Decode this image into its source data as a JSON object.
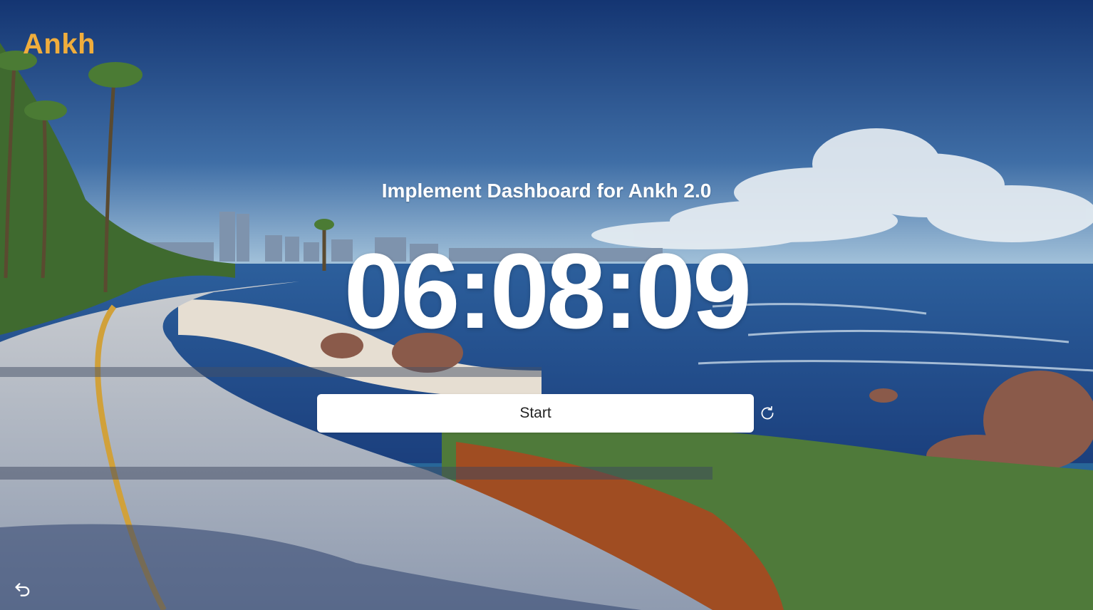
{
  "brand": {
    "name": "Ankh",
    "color": "#f0ad3c"
  },
  "task": {
    "title": "Implement Dashboard for Ankh 2.0"
  },
  "timer": {
    "display": "06:08:09"
  },
  "controls": {
    "start_label": "Start",
    "reset_icon": "refresh-icon",
    "back_icon": "undo-arrow-icon"
  },
  "background": {
    "scene": "coastal-road-illustration"
  }
}
